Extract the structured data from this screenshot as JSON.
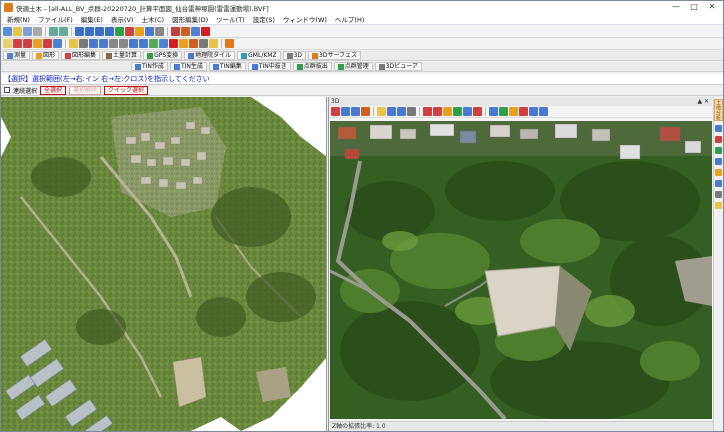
{
  "window": {
    "title": "快適土木 - [all-ALL_BV_点群-20220720_計算平面図_仙台雷神塚園(雷雷運動場).BVF]",
    "controls": [
      "—",
      "□",
      "✕"
    ]
  },
  "menu": {
    "items": [
      "新規(N)",
      "ファイル(F)",
      "編集(E)",
      "表示(V)",
      "土木(C)",
      "図形編集(D)",
      "ツール(T)",
      "設定(S)",
      "ウィンドウ(W)",
      "ヘルプ(H)"
    ]
  },
  "tabs": {
    "row1": [
      "測量",
      "図形",
      "図形編集",
      "土量計算",
      "GPS変換",
      "地理院タイル",
      "GML/KMZ",
      "3D",
      "3Dサーフェス"
    ],
    "row2": [
      "TIN作成",
      "TIN生成",
      "TIN編集",
      "TIN中抜き",
      "点群抜出",
      "点群管理",
      "3Dビューア"
    ]
  },
  "prompt": {
    "text": "【選択】選択範囲(左→右:イン 右→左:クロス)を指示してください"
  },
  "options": {
    "continuous_label": "連続選択",
    "btn_select_all": "全選択",
    "btn_cancel_select": "選択解除",
    "btn_quick_select": "クイック選択"
  },
  "view3d": {
    "header": "3D",
    "header_ctrls": "▲ ✕",
    "status": "Z軸の拡張比率: 1.0"
  },
  "sidebar": {
    "tab_label": "土地分析"
  },
  "colors": {
    "accent": "#e07a1a",
    "prompt": "#0018c8",
    "danger": "#cc0000"
  }
}
